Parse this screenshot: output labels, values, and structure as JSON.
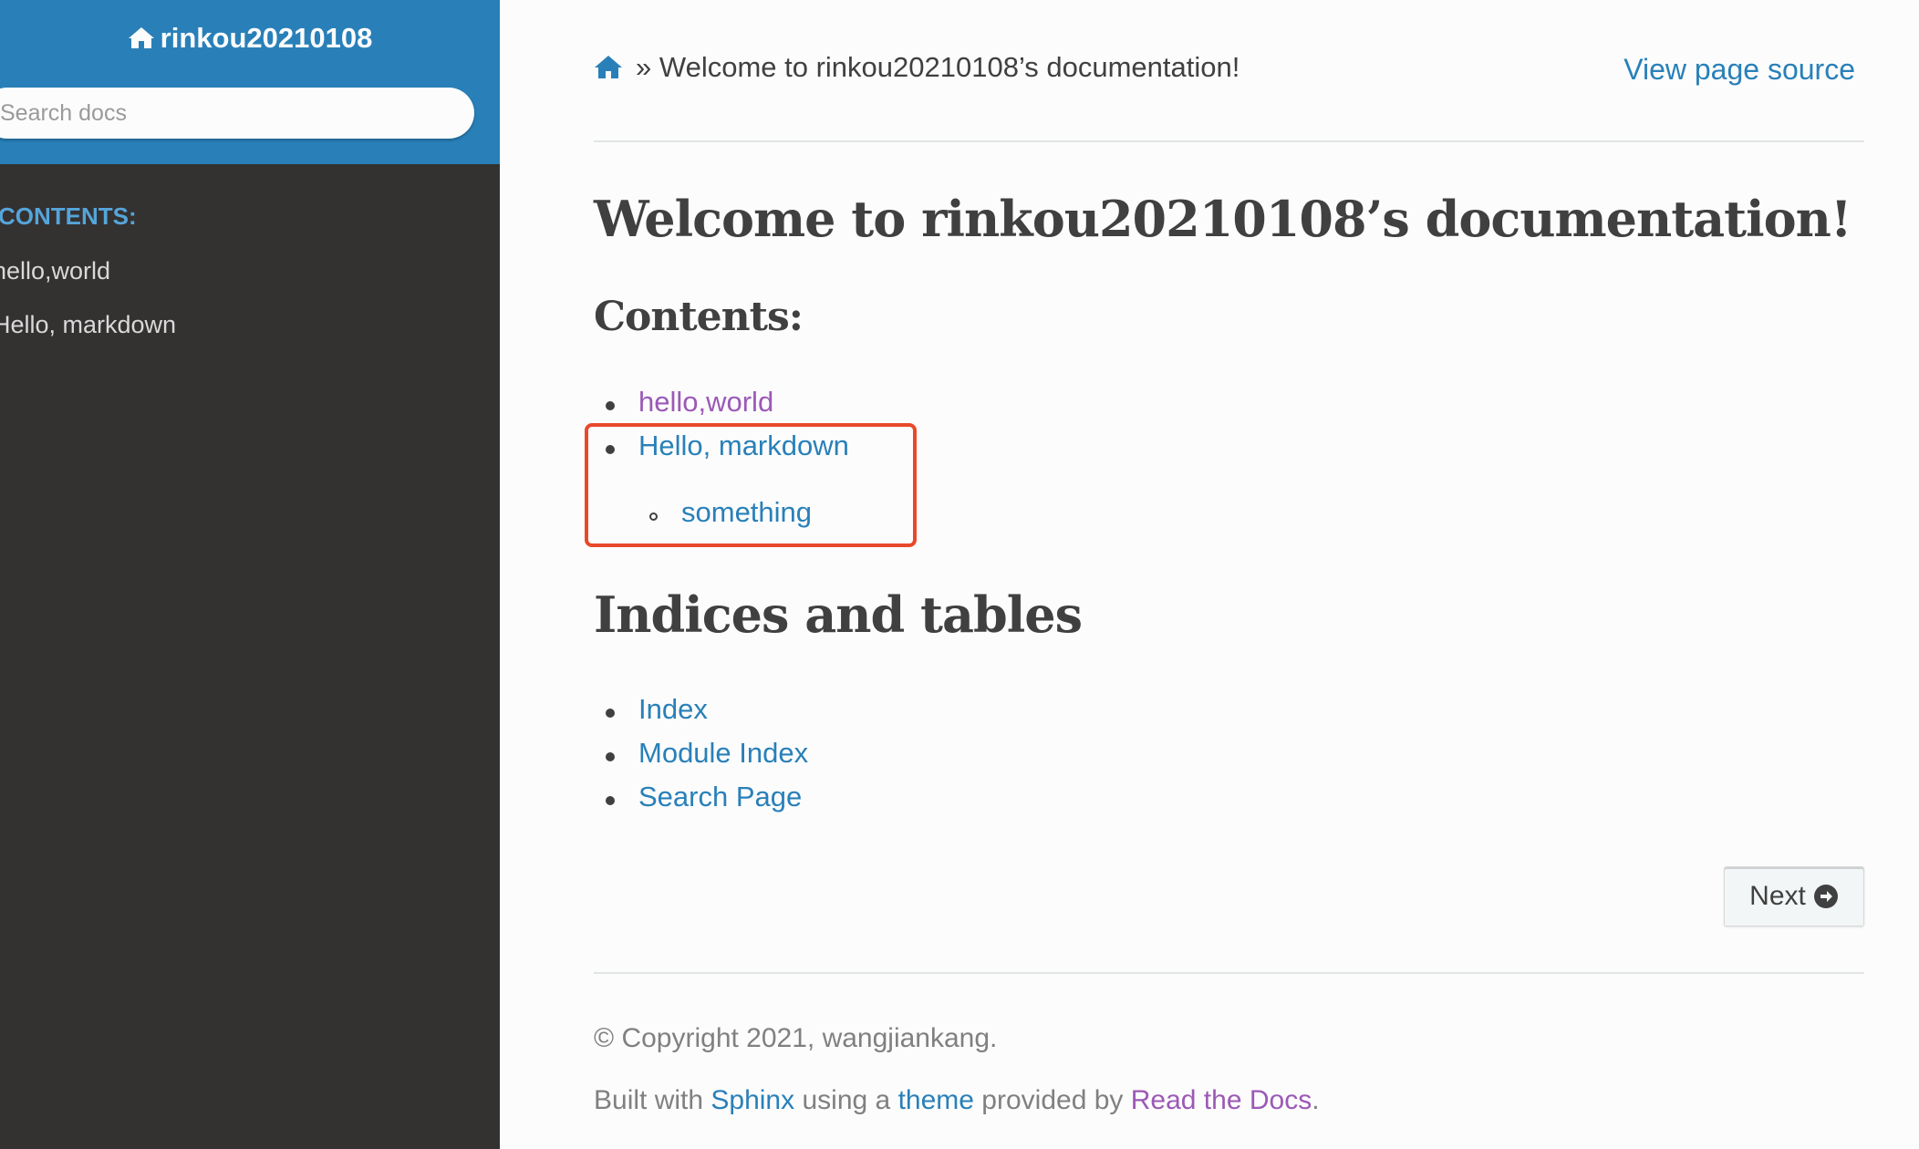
{
  "sidebar": {
    "project_name": "rinkou20210108",
    "search_placeholder": "Search docs",
    "caption": "CONTENTS:",
    "items": [
      {
        "label": "hello,world"
      },
      {
        "label": "Hello, markdown"
      }
    ]
  },
  "breadcrumb": {
    "separator": "»",
    "current": "Welcome to rinkou20210108’s documentation!",
    "view_source": "View page source"
  },
  "page": {
    "title": "Welcome to rinkou20210108’s documentation!",
    "contents_heading": "Contents:",
    "toc": [
      {
        "label": "hello,world"
      },
      {
        "label": "Hello, markdown",
        "children": [
          {
            "label": "something"
          }
        ]
      }
    ],
    "indices_heading": "Indices and tables",
    "indices": [
      {
        "label": "Index"
      },
      {
        "label": "Module Index"
      },
      {
        "label": "Search Page"
      }
    ],
    "next_label": "Next"
  },
  "footer": {
    "copyright": "© Copyright 2021, wangjiankang.",
    "built_prefix": "Built with",
    "sphinx": "Sphinx",
    "using_a": "using a",
    "theme": "theme",
    "provided_by": "provided by",
    "rtd": "Read the Docs",
    "period": "."
  },
  "colors": {
    "sidebar_header": "#2980b9",
    "sidebar_bg": "#343131",
    "link": "#2980b9",
    "visited_link": "#9b59b6",
    "highlight_box": "#e8492a"
  }
}
